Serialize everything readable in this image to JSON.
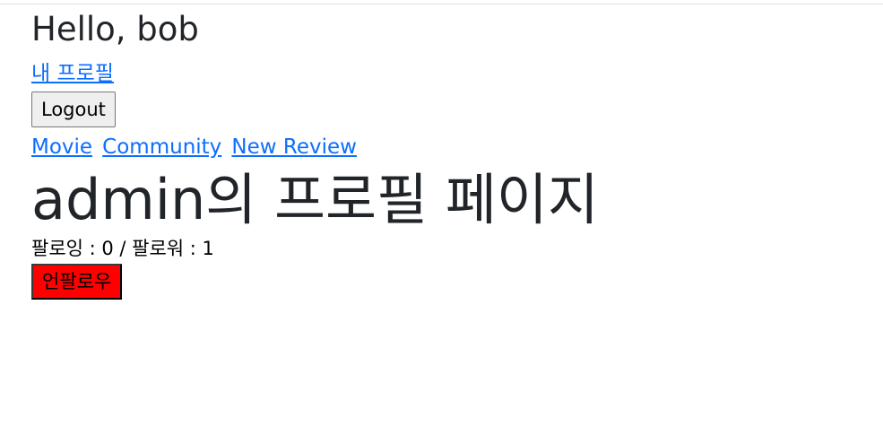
{
  "header": {
    "greeting": "Hello, bob",
    "my_profile_link": "내 프로필",
    "logout_label": "Logout"
  },
  "nav": {
    "items": [
      {
        "label": "Movie"
      },
      {
        "label": "Community"
      },
      {
        "label": "New Review"
      }
    ]
  },
  "profile": {
    "title": "admin의 프로필 페이지",
    "follow_stats": "팔로잉 : 0 / 팔로워 : 1",
    "unfollow_label": "언팔로우"
  },
  "colors": {
    "link": "#0d6efd",
    "unfollow_bg": "#ff0000"
  }
}
